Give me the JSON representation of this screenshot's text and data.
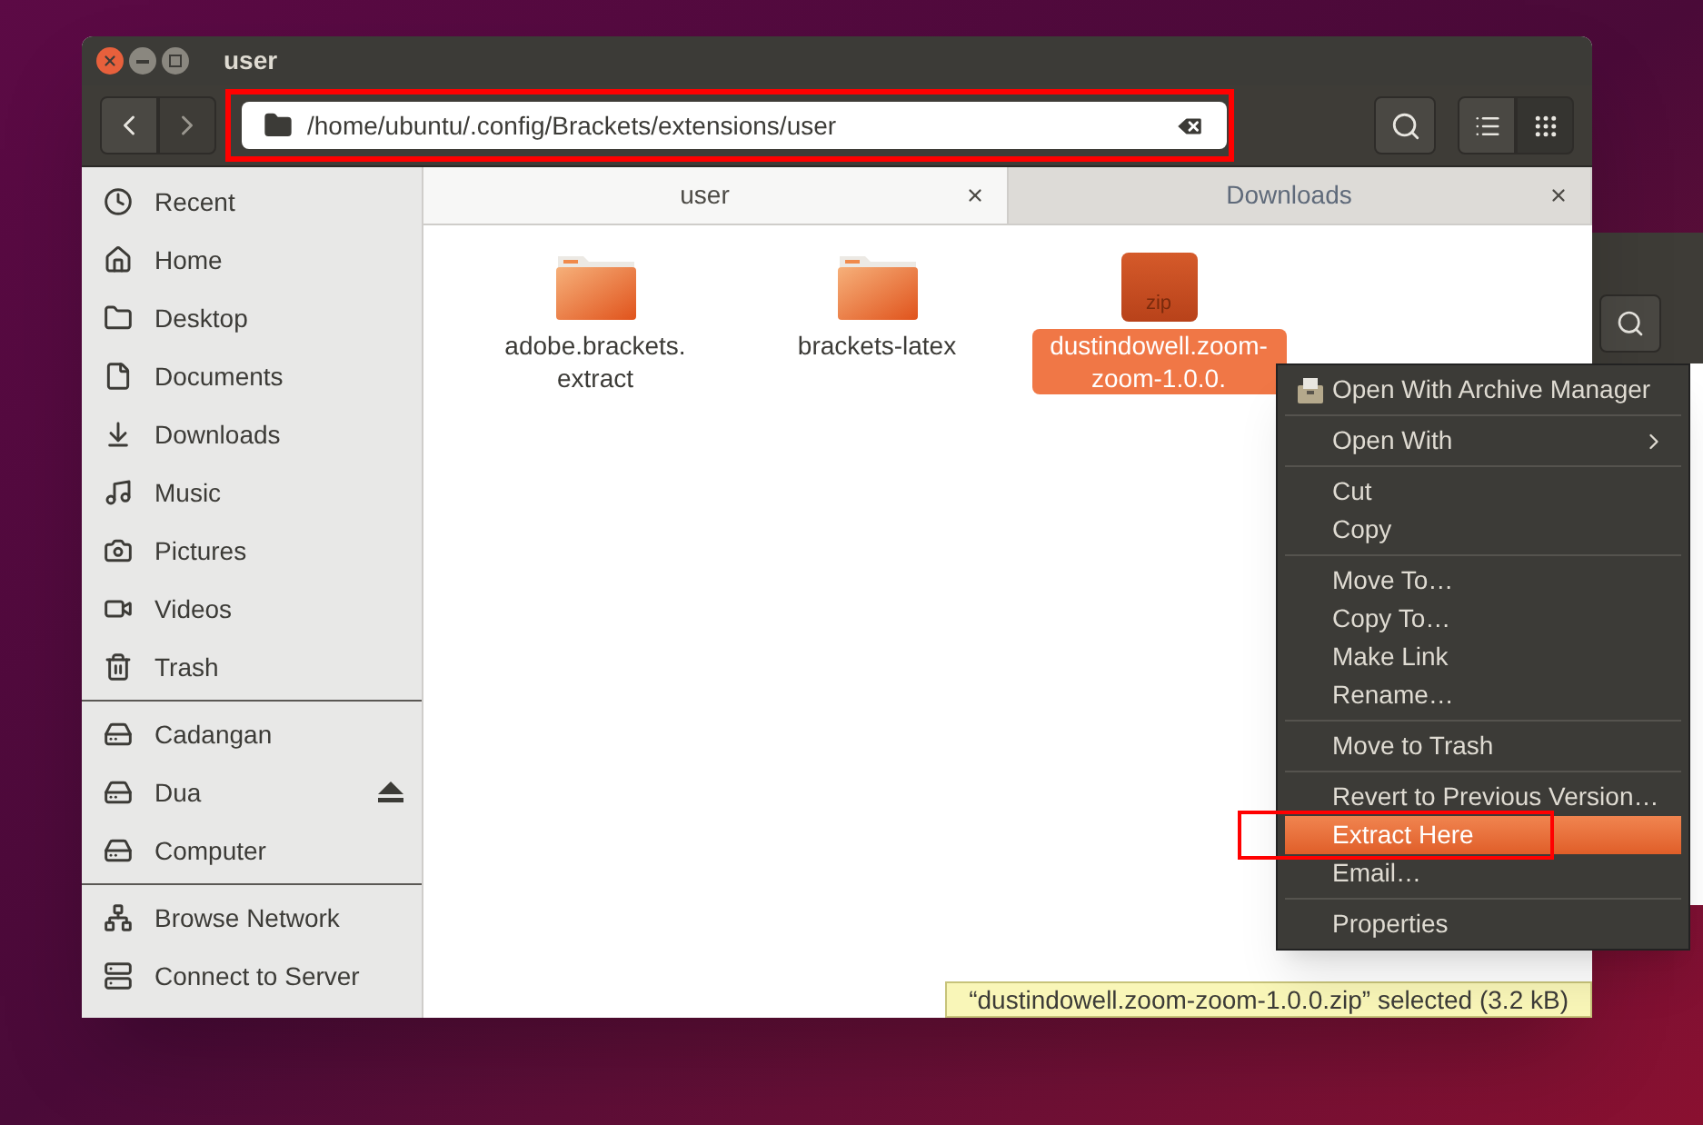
{
  "window": {
    "title": "user"
  },
  "toolbar": {
    "path": "/home/ubuntu/.config/Brackets/extensions/user",
    "view_buttons": [
      {
        "selected": false
      },
      {
        "selected": true
      }
    ]
  },
  "sidebar": {
    "sections": [
      [
        {
          "label": "Recent",
          "eject": false
        },
        {
          "label": "Home",
          "eject": false
        },
        {
          "label": "Desktop",
          "eject": false
        },
        {
          "label": "Documents",
          "eject": false
        },
        {
          "label": "Downloads",
          "eject": false
        },
        {
          "label": "Music",
          "eject": false
        },
        {
          "label": "Pictures",
          "eject": false
        },
        {
          "label": "Videos",
          "eject": false
        },
        {
          "label": "Trash",
          "eject": false
        }
      ],
      [
        {
          "label": "Cadangan",
          "eject": false
        },
        {
          "label": "Dua",
          "eject": true
        },
        {
          "label": "Computer",
          "eject": false
        }
      ],
      [
        {
          "label": "Browse Network",
          "eject": false
        },
        {
          "label": "Connect to Server",
          "eject": false
        }
      ]
    ]
  },
  "tabs": [
    {
      "label": "user",
      "selected": true
    },
    {
      "label": "Downloads",
      "selected": false
    }
  ],
  "files": [
    {
      "name": "adobe.brackets.extract",
      "kind": "folder",
      "selected": false
    },
    {
      "name": "brackets-latex",
      "kind": "folder",
      "selected": false
    },
    {
      "name": "dustindowell.zoom-zoom-1.0.0.",
      "kind": "zip",
      "icon_label": "zip",
      "selected": true
    }
  ],
  "context_menu": {
    "groups": [
      [
        {
          "label": "Open With Archive Manager",
          "kind": "app",
          "selected": false
        }
      ],
      [
        {
          "label": "Open With",
          "kind": "submenu",
          "selected": false
        }
      ],
      [
        {
          "label": "Cut",
          "kind": "action",
          "selected": false
        },
        {
          "label": "Copy",
          "kind": "action",
          "selected": false
        }
      ],
      [
        {
          "label": "Move To…",
          "kind": "action",
          "selected": false
        },
        {
          "label": "Copy To…",
          "kind": "action",
          "selected": false
        },
        {
          "label": "Make Link",
          "kind": "action",
          "selected": false
        },
        {
          "label": "Rename…",
          "kind": "action",
          "selected": false
        }
      ],
      [
        {
          "label": "Move to Trash",
          "kind": "action",
          "selected": false
        }
      ],
      [
        {
          "label": "Revert to Previous Version…",
          "kind": "action",
          "selected": false
        },
        {
          "label": "Extract Here",
          "kind": "action",
          "selected": true
        },
        {
          "label": "Email…",
          "kind": "action",
          "selected": false
        }
      ],
      [
        {
          "label": "Properties",
          "kind": "action",
          "selected": false
        }
      ]
    ]
  },
  "status_bar": {
    "text": "“dustindowell.zoom-zoom-1.0.0.zip” selected (3.2 kB)"
  }
}
